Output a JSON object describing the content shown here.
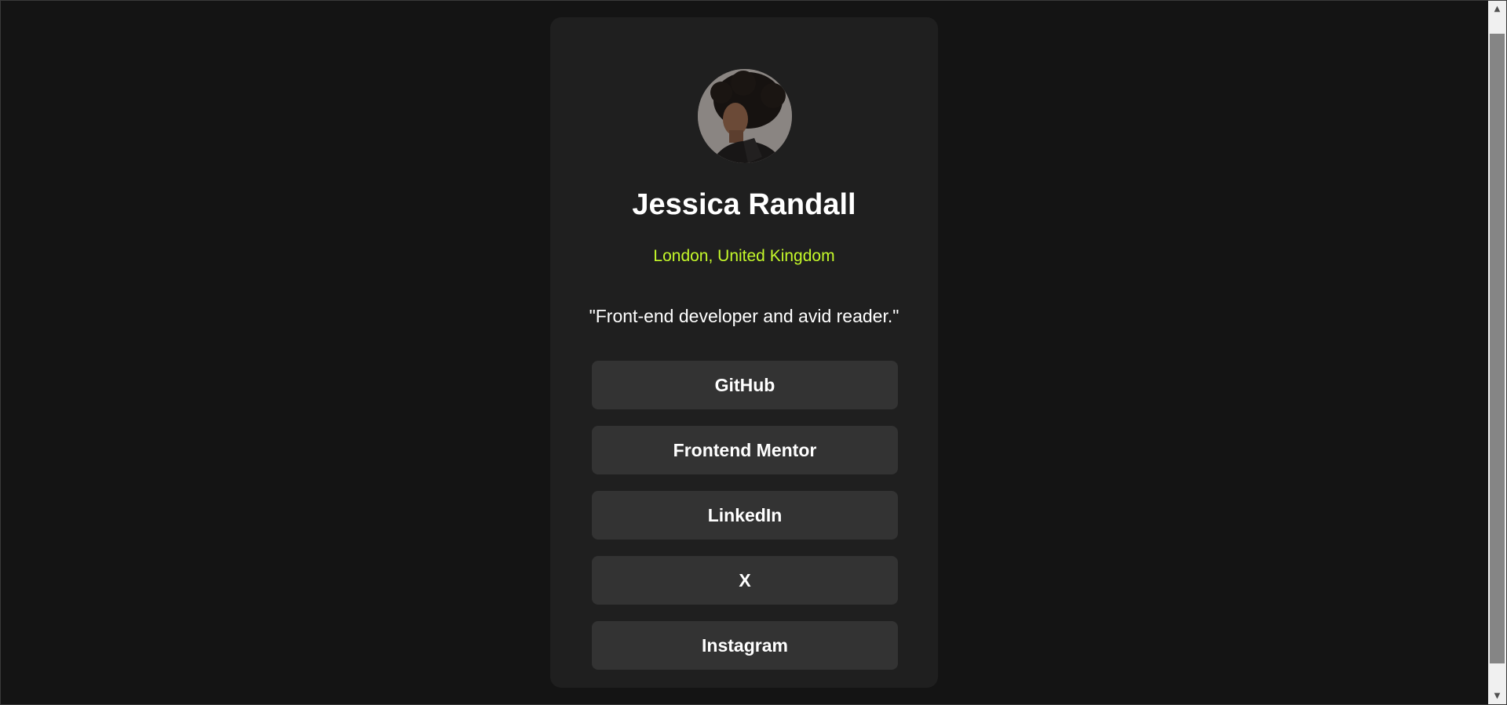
{
  "profile": {
    "name": "Jessica Randall",
    "location": "London, United Kingdom",
    "bio": "\"Front-end developer and avid reader.\""
  },
  "links": [
    {
      "label": "GitHub"
    },
    {
      "label": "Frontend Mentor"
    },
    {
      "label": "LinkedIn"
    },
    {
      "label": "X"
    },
    {
      "label": "Instagram"
    }
  ],
  "scrollbar": {
    "up_icon": "triangle-up-icon",
    "down_icon": "triangle-down-icon"
  },
  "colors": {
    "background": "#141414",
    "card": "#1f1f1f",
    "button": "#333333",
    "accent": "#c4f82a",
    "text": "#ffffff"
  }
}
